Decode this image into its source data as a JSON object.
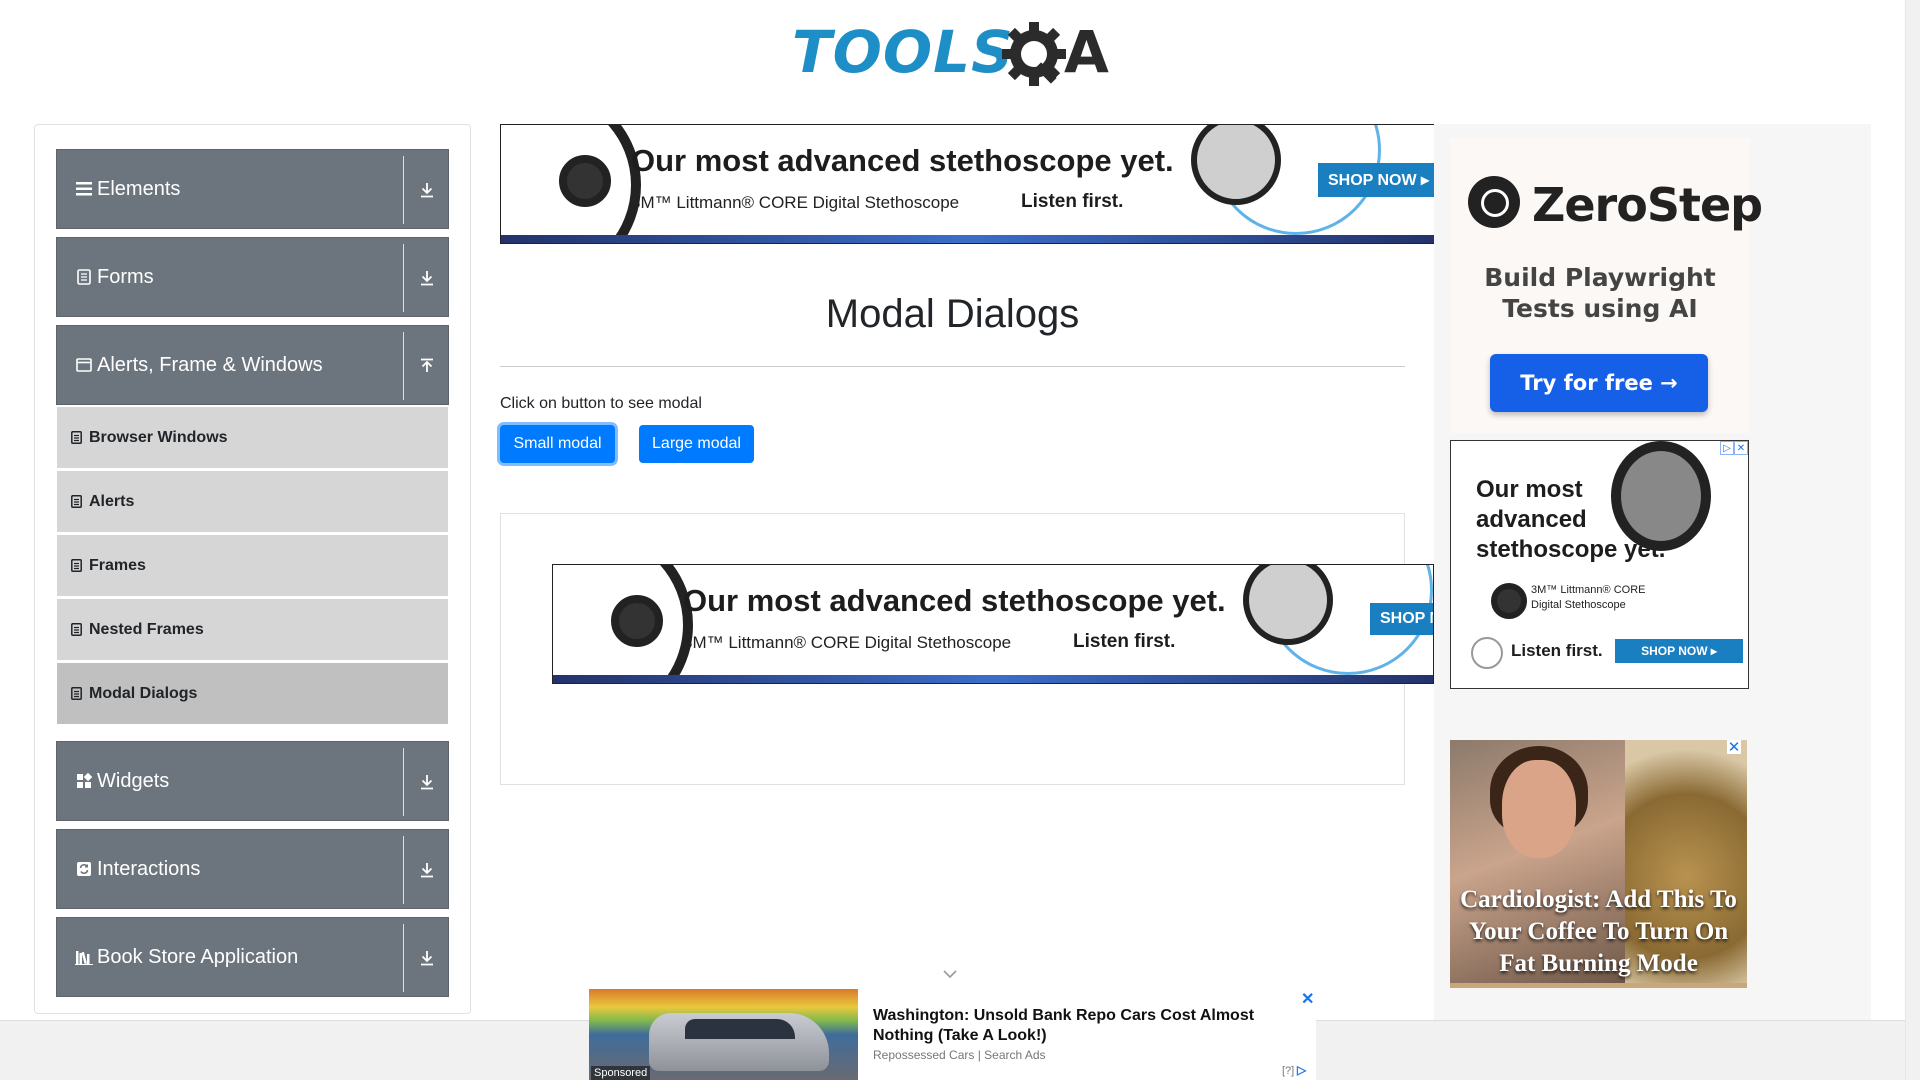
{
  "header": {
    "logo_text": "TOOLS",
    "logo_text_2": "QA"
  },
  "sidebar": {
    "groups": [
      {
        "label": "Elements",
        "icon": "hamburger-icon",
        "arrow": "download-icon"
      },
      {
        "label": "Forms",
        "icon": "document-icon",
        "arrow": "download-icon"
      },
      {
        "label": "Alerts, Frame & Windows",
        "icon": "window-icon",
        "arrow": "upload-icon"
      },
      {
        "label": "Widgets",
        "icon": "grid-icon",
        "arrow": "download-icon"
      },
      {
        "label": "Interactions",
        "icon": "interactions-icon",
        "arrow": "download-icon"
      },
      {
        "label": "Book Store Application",
        "icon": "books-icon",
        "arrow": "download-icon"
      }
    ],
    "sub_items": [
      {
        "label": "Browser Windows"
      },
      {
        "label": "Alerts"
      },
      {
        "label": "Frames"
      },
      {
        "label": "Nested Frames"
      },
      {
        "label": "Modal Dialogs",
        "active": true
      }
    ]
  },
  "main": {
    "title": "Modal Dialogs",
    "instruction": "Click on button to see modal",
    "small_modal_label": "Small modal",
    "large_modal_label": "Large modal"
  },
  "ads": {
    "steth_headline": "Our most advanced stethoscope yet.",
    "steth_sub": "3M™ Littmann® CORE Digital Stethoscope",
    "steth_listen": "Listen first.",
    "steth_shop": "SHOP NOW ▸",
    "steth_shop_cropped": "SHOP N",
    "steth_square_headline_1": "Our most",
    "steth_square_headline_2": "advanced",
    "steth_square_headline_3": "stethoscope yet.",
    "steth_square_sub_1": "3M™ Littmann® CORE",
    "steth_square_sub_2": "Digital Stethoscope",
    "zerostep_name": "ZeroStep",
    "zerostep_tagline_1": "Build Playwright",
    "zerostep_tagline_2": "Tests using AI",
    "zerostep_cta": "Try for free →",
    "coffee_caption": "Cardiologist: Add This To Your Coffee To Turn On Fat Burning Mode",
    "sticky_title": "Washington: Unsold Bank Repo Cars Cost Almost Nothing (Take A Look!)",
    "sticky_source": "Repossessed Cars | Search Ads",
    "sticky_sponsored": "Sponsored",
    "sticky_q": "[?]",
    "close_glyph": "✕"
  },
  "colors": {
    "sidebar_header": "#6c757d",
    "sub_item": "#d6d6d6",
    "sub_item_active": "#c0c0c0",
    "button_primary": "#007bff",
    "logo_blue": "#1e8fc6"
  }
}
